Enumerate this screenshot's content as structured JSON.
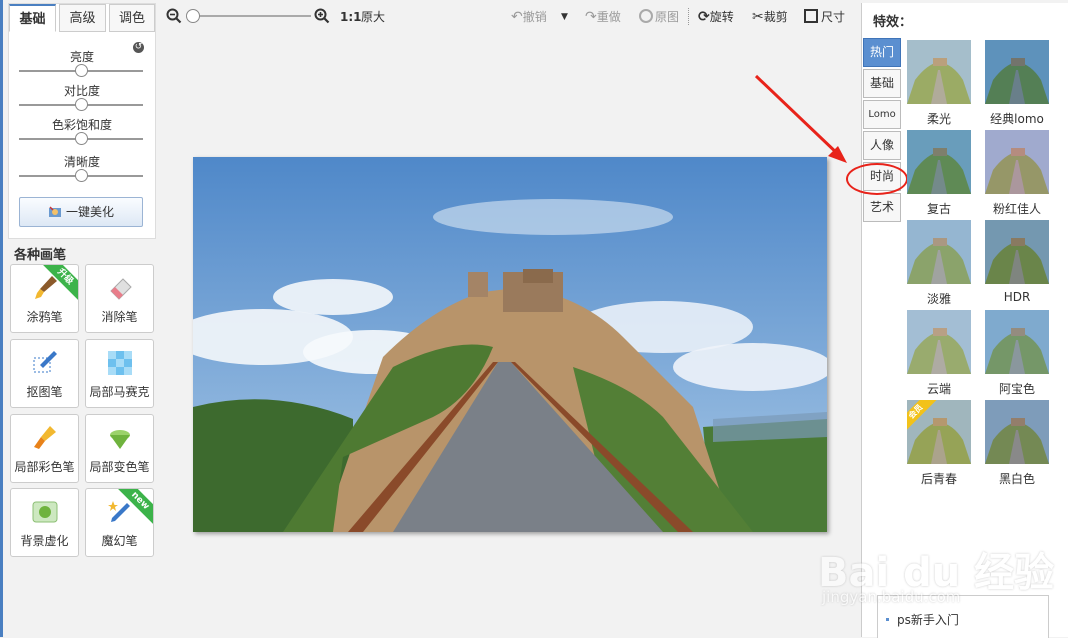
{
  "adjust_tabs": [
    "基础",
    "高级",
    "调色"
  ],
  "sliders": [
    {
      "label": "亮度",
      "value": 0.5
    },
    {
      "label": "对比度",
      "value": 0.5
    },
    {
      "label": "色彩饱和度",
      "value": 0.5
    },
    {
      "label": "清晰度",
      "value": 0.5
    }
  ],
  "beautify_label": "一键美化",
  "brushes_title": "各种画笔",
  "brushes": [
    {
      "label": "涂鸦笔",
      "icon": "brush-icon",
      "badge": "升级"
    },
    {
      "label": "消除笔",
      "icon": "eraser-icon",
      "badge": ""
    },
    {
      "label": "抠图笔",
      "icon": "cutout-pen-icon",
      "badge": ""
    },
    {
      "label": "局部马赛克",
      "icon": "mosaic-icon",
      "badge": ""
    },
    {
      "label": "局部彩色笔",
      "icon": "color-brush-icon",
      "badge": ""
    },
    {
      "label": "局部变色笔",
      "icon": "paint-bucket-icon",
      "badge": ""
    },
    {
      "label": "背景虚化",
      "icon": "blur-icon",
      "badge": ""
    },
    {
      "label": "魔幻笔",
      "icon": "magic-pen-icon",
      "badge": "new"
    }
  ],
  "toolbar": {
    "zoom_ratio": "1:1",
    "original_size": "原大",
    "undo": "撤销",
    "redo": "重做",
    "original": "原图",
    "rotate": "旋转",
    "crop": "裁剪",
    "size": "尺寸",
    "zoom_level": 0.0
  },
  "effects": {
    "title": "特效：",
    "categories": [
      "热门",
      "基础",
      "Lomo",
      "人像",
      "时尚",
      "艺术"
    ],
    "active_category": "热门",
    "highlighted_category": "时尚",
    "items": [
      {
        "label": "柔光",
        "tint": "#f5e7b8",
        "badge": ""
      },
      {
        "label": "经典lomo",
        "tint": "#2a6a8a",
        "badge": ""
      },
      {
        "label": "复古",
        "tint": "#4a8a8a",
        "badge": ""
      },
      {
        "label": "粉红佳人",
        "tint": "#e8b0c0",
        "badge": ""
      },
      {
        "label": "淡雅",
        "tint": "#c8d0c8",
        "badge": ""
      },
      {
        "label": "HDR",
        "tint": "#6a7a6a",
        "badge": ""
      },
      {
        "label": "云端",
        "tint": "#f0e8d0",
        "badge": ""
      },
      {
        "label": "阿宝色",
        "tint": "#8ab0c0",
        "badge": ""
      },
      {
        "label": "后青春",
        "tint": "#e8d090",
        "badge": "会员"
      },
      {
        "label": "黑白色",
        "tint": "#888888",
        "badge": ""
      }
    ]
  },
  "watermark": {
    "text": "Bai du 经验",
    "url": "jingyan.baidu.com"
  },
  "bottom_link": "ps新手入门",
  "colors": {
    "accent": "#4a7fc1",
    "arrow": "#e8231a"
  }
}
